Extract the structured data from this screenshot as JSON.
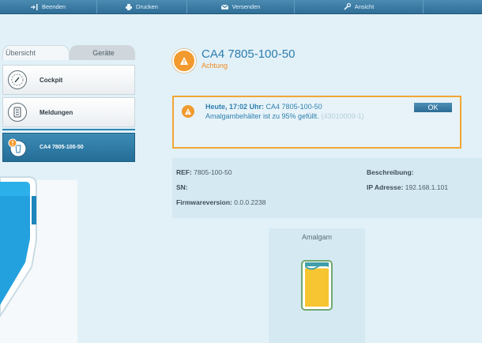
{
  "toolbar": {
    "items": [
      {
        "label": "Beenden",
        "icon": "exit-icon"
      },
      {
        "label": "Drucken",
        "icon": "printer-icon"
      },
      {
        "label": "Versenden",
        "icon": "send-icon"
      },
      {
        "label": "Ansicht",
        "icon": "wrench-icon"
      }
    ]
  },
  "sidebar": {
    "tabs": [
      "Übersicht",
      "Geräte"
    ],
    "items": [
      {
        "label": "Cockpit",
        "icon": "gauge-icon"
      },
      {
        "label": "Meldungen",
        "icon": "list-icon"
      },
      {
        "label": "CA4 7805-100-50",
        "icon": "device-warning-icon"
      }
    ]
  },
  "device": {
    "title": "CA4 7805-100-50",
    "status": "Achtung"
  },
  "alert": {
    "time": "Heute, 17:02 Uhr:",
    "device": "CA4 7805-100-50",
    "message": "Amalgambehälter ist zu 95% gefüllt.",
    "code": "(43010009-1)",
    "ok_label": "OK"
  },
  "info": {
    "ref_label": "REF:",
    "ref_value": "7805-100-50",
    "sn_label": "SN:",
    "sn_value": "",
    "firmware_label": "Firmwareversion:",
    "firmware_value": "0.0.0.2238",
    "description_label": "Beschreibung:",
    "description_value": "",
    "ip_label": "IP Adresse:",
    "ip_value": "192.168.1.101"
  },
  "amalgam": {
    "label": "Amalgam",
    "fill_percent": 95
  },
  "colors": {
    "accent": "#2e7cad",
    "warning": "#f29a2e",
    "alert_border": "#f2a634",
    "amalgam_fill": "#f7c531"
  }
}
